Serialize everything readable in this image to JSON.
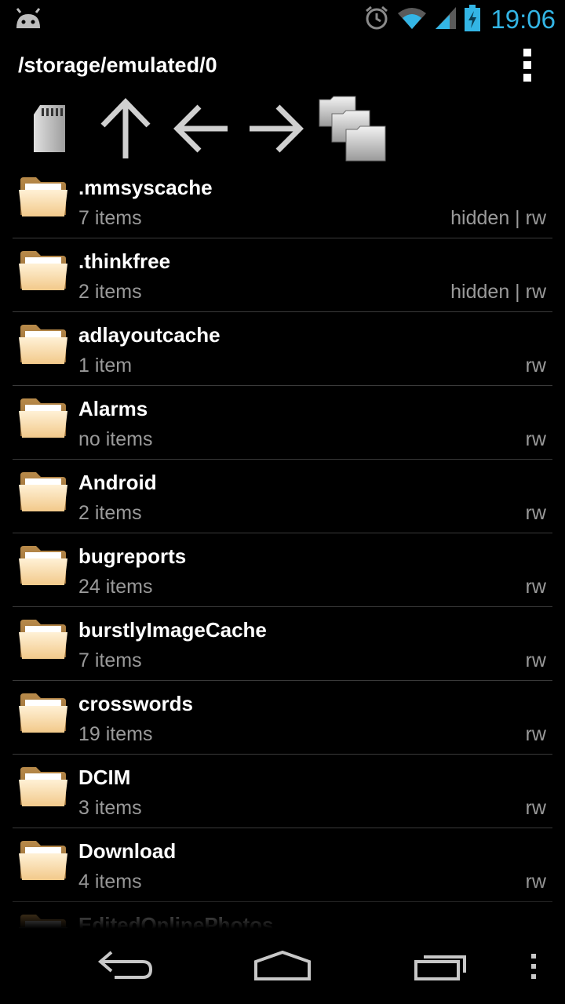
{
  "status_bar": {
    "time": "19:06",
    "icons": [
      "android-icon",
      "alarm-icon",
      "wifi-icon",
      "signal-icon",
      "battery-charging-icon"
    ],
    "accent_color": "#33b5e5"
  },
  "action_bar": {
    "title": "/storage/emulated/0",
    "menu_icon": "overflow-menu-icon"
  },
  "toolbar": {
    "buttons": [
      {
        "name": "sd-card-button",
        "icon": "sd-card-icon"
      },
      {
        "name": "up-button",
        "icon": "arrow-up-icon"
      },
      {
        "name": "back-button",
        "icon": "arrow-left-icon"
      },
      {
        "name": "forward-button",
        "icon": "arrow-right-icon"
      },
      {
        "name": "multi-select-button",
        "icon": "stacked-folders-icon"
      }
    ]
  },
  "files": [
    {
      "name": ".mmsyscache",
      "count": "7 items",
      "perm": "hidden | rw"
    },
    {
      "name": ".thinkfree",
      "count": "2 items",
      "perm": "hidden | rw"
    },
    {
      "name": "adlayoutcache",
      "count": "1 item",
      "perm": "rw"
    },
    {
      "name": "Alarms",
      "count": "no items",
      "perm": "rw"
    },
    {
      "name": "Android",
      "count": "2 items",
      "perm": "rw"
    },
    {
      "name": "bugreports",
      "count": "24 items",
      "perm": "rw"
    },
    {
      "name": "burstlyImageCache",
      "count": "7 items",
      "perm": "rw"
    },
    {
      "name": "crosswords",
      "count": "19 items",
      "perm": "rw"
    },
    {
      "name": "DCIM",
      "count": "3 items",
      "perm": "rw"
    },
    {
      "name": "Download",
      "count": "4 items",
      "perm": "rw"
    },
    {
      "name": "EditedOnlinePhotos",
      "count": "",
      "perm": ""
    }
  ],
  "nav_bar": {
    "buttons": [
      "back-icon",
      "home-icon",
      "recents-icon",
      "menu-icon"
    ]
  }
}
